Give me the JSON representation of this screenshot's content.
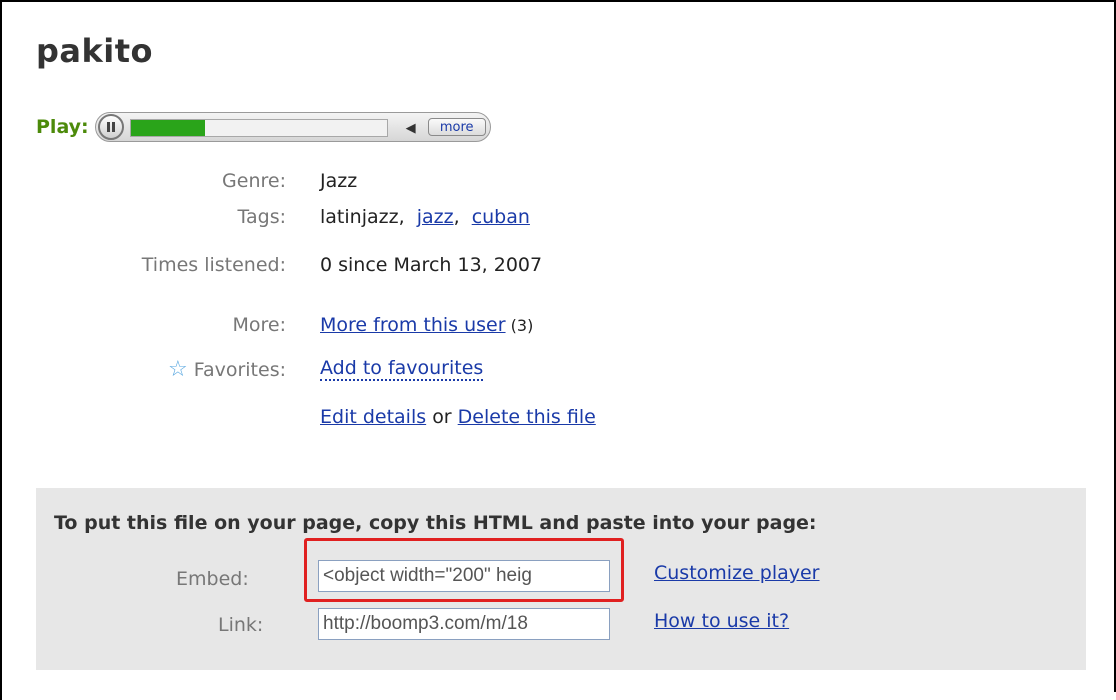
{
  "track": {
    "title": "pakito",
    "play_label": "Play:",
    "progress_percent": 29,
    "more_label": "more"
  },
  "details": {
    "genre_label": "Genre:",
    "genre_value": "Jazz",
    "tags_label": "Tags:",
    "tags": [
      {
        "text": "latinjazz",
        "link": false
      },
      {
        "text": "jazz",
        "link": true
      },
      {
        "text": "cuban",
        "link": true
      }
    ],
    "times_label": "Times listened:",
    "times_value": "0 since March 13, 2007",
    "more_label": "More:",
    "more_link": "More from this user",
    "more_count": "(3)",
    "favorites_label": "Favorites:",
    "favorites_link": "Add to favourites",
    "edit_link": "Edit details",
    "or_text": "or",
    "delete_link": "Delete this file"
  },
  "embed": {
    "heading": "To put this file on your page, copy this HTML and paste into your page:",
    "embed_label": "Embed:",
    "embed_value": "<object width=\"200\" heig",
    "link_label": "Link:",
    "link_value": "http://boomp3.com/m/18",
    "customize_link": "Customize player",
    "howto_link": "How to use it?"
  },
  "colors": {
    "play_green": "#4c8a0a",
    "progress_green": "#2aa41a",
    "link_blue": "#1a3aa8",
    "highlight_red": "#e02020"
  }
}
